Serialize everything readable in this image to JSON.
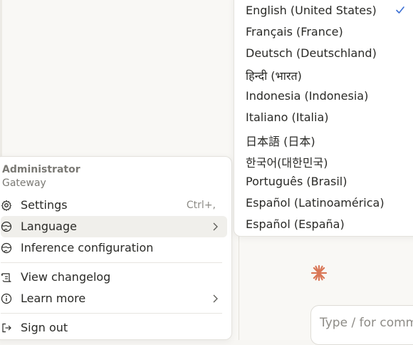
{
  "account_menu": {
    "user_name": "Administrator",
    "org_name": "Gateway",
    "items": [
      {
        "label": "Settings",
        "shortcut": "Ctrl+,",
        "icon": "gear-icon"
      },
      {
        "label": "Language",
        "icon": "globe-icon",
        "has_submenu": true
      },
      {
        "label": "Inference configuration",
        "icon": "globe-icon"
      },
      {
        "label": "View changelog",
        "icon": "scroll-icon"
      },
      {
        "label": "Learn more",
        "icon": "info-icon",
        "has_submenu": true
      },
      {
        "label": "Sign out",
        "icon": "sign-out-icon"
      }
    ]
  },
  "language_menu": {
    "selected": "English (United States)",
    "options": [
      "English (United States)",
      "Français (France)",
      "Deutsch (Deutschland)",
      "हिन्दी (भारत)",
      "Indonesia (Indonesia)",
      "Italiano (Italia)",
      "日本語 (日本)",
      "한국어(대한민국)",
      "Português (Brasil)",
      "Español (Latinoamérica)",
      "Español (España)"
    ]
  },
  "chat": {
    "input_placeholder": "Type / for commands"
  },
  "colors": {
    "accent": "#d97757",
    "check": "#3b6fd4"
  }
}
